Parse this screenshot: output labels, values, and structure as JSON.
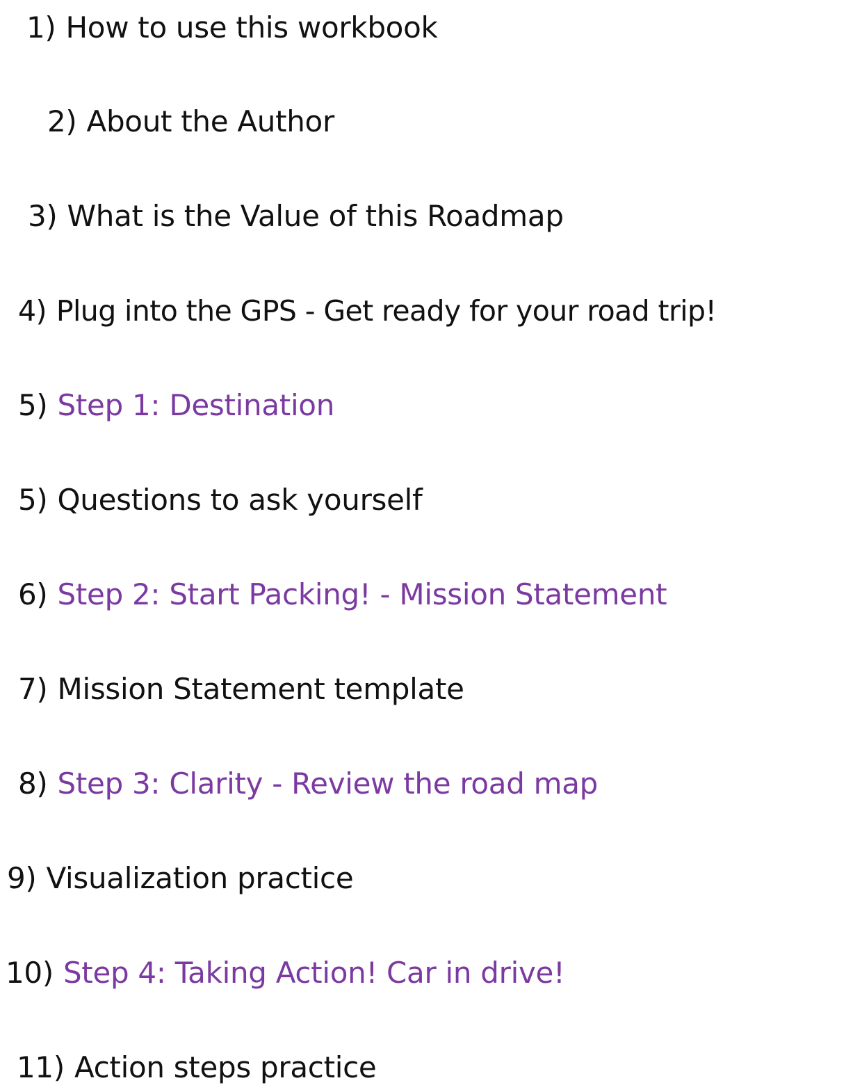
{
  "toc": {
    "items": [
      {
        "number": "1)",
        "title": "How to use this workbook",
        "accent": false
      },
      {
        "number": "2)",
        "title": "About the Author",
        "accent": false
      },
      {
        "number": "3)",
        "title": "What is the Value of this Roadmap",
        "accent": false
      },
      {
        "number": "4)",
        "title": "Plug into the GPS - Get ready for your road trip!",
        "accent": false
      },
      {
        "number": "5)",
        "title": "Step 1: Destination",
        "accent": true
      },
      {
        "number": "5)",
        "title": "Questions to ask yourself",
        "accent": false
      },
      {
        "number": "6)",
        "title": "Step 2: Start Packing! - Mission Statement",
        "accent": true
      },
      {
        "number": "7)",
        "title": "Mission Statement template",
        "accent": false
      },
      {
        "number": "8)",
        "title": "Step 3: Clarity - Review the road map",
        "accent": true
      },
      {
        "number": "9)",
        "title": "Visualization practice",
        "accent": false
      },
      {
        "number": "10)",
        "title": "Step 4: Taking Action! Car in drive!",
        "accent": true
      },
      {
        "number": "11)",
        "title": "Action steps practice",
        "accent": false
      }
    ]
  },
  "colors": {
    "text": "#111111",
    "accent": "#7b3aa1",
    "background": "#ffffff"
  }
}
